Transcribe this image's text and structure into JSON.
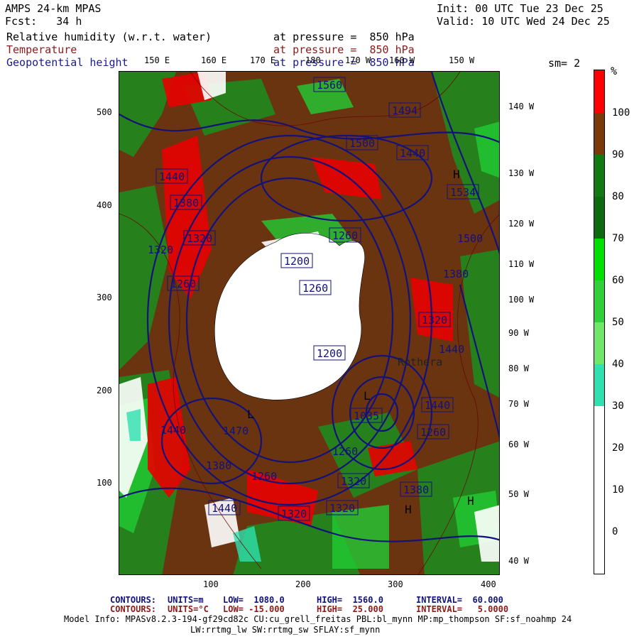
{
  "header": {
    "title": "AMPS 24-km MPAS",
    "forecast": "Fcst:   34 h",
    "init": "Init: 00 UTC Tue 23 Dec 25",
    "valid": "Valid: 10 UTC Wed 24 Dec 25"
  },
  "fields": [
    {
      "name": "Relative humidity (w.r.t. water)",
      "level": "at pressure =  850 hPa"
    },
    {
      "name": "Temperature",
      "level": "at pressure =  850 hPa"
    },
    {
      "name": "Geopotential height",
      "level": "at pressure =  850 hPa"
    }
  ],
  "smoothing": "sm= 2",
  "top_lon_labels": [
    "150 E",
    "160 E",
    "170 E",
    "180",
    "170 W",
    "160 W",
    "150 W"
  ],
  "right_lon_labels": [
    "140 W",
    "130 W",
    "120 W",
    "110 W",
    "100 W",
    "90 W",
    "80 W",
    "70 W",
    "60 W",
    "50 W",
    "40 W"
  ],
  "y_ticks": [
    "500",
    "400",
    "300",
    "200",
    "100"
  ],
  "x_ticks": [
    "100",
    "200",
    "300",
    "400"
  ],
  "colorbar": {
    "unit": "%",
    "labels": [
      "100",
      "90",
      "80",
      "70",
      "60",
      "50",
      "40",
      "30",
      "20",
      "10",
      "0"
    ],
    "colors": [
      "#ff0000",
      "#7b3a0a",
      "#127a12",
      "#0e6a0e",
      "#00e000",
      "#2fd03a",
      "#6fe86a",
      "#30e0b0",
      "#ffffff",
      "#ffffff",
      "#ffffff",
      "#ffffff"
    ]
  },
  "map": {
    "contour_labels": [
      "1560",
      "1494",
      "1440",
      "1534",
      "1440",
      "1500",
      "1380",
      "1320",
      "1260",
      "1200",
      "1260",
      "1320",
      "1380",
      "1440",
      "1260",
      "1320",
      "1440",
      "1440",
      "1380",
      "1260",
      "1320",
      "1440",
      "1380",
      "1320",
      "1260",
      "1035",
      "1200",
      "1260",
      "1320",
      "1380",
      "1440",
      "1470",
      "1500"
    ],
    "place_label": "Rothera",
    "high_markers": [
      "H",
      "H",
      "H"
    ],
    "low_markers": [
      "L",
      "L"
    ]
  },
  "footer": {
    "line1_label": "CONTOURS:",
    "line1_units": "UNITS=m",
    "line1_low": "LOW=  1080.0",
    "line1_high": "HIGH=  1560.0",
    "line1_interval": "INTERVAL=  60.000",
    "line2_label": "CONTOURS:",
    "line2_units": "UNITS=°C",
    "line2_low": "LOW= -15.000",
    "line2_high": "HIGH=  25.000",
    "line2_interval": "INTERVAL=   5.0000",
    "model_info_1": "Model Info: MPASv8.2.3-194-gf29cd82c CU:cu_grell_freitas PBL:bl_mynn MP:mp_thompson SF:sf_noahmp 24",
    "model_info_2": "LW:rrtmg_lw SW:rrtmg_sw SFLAY:sf_mynn"
  }
}
